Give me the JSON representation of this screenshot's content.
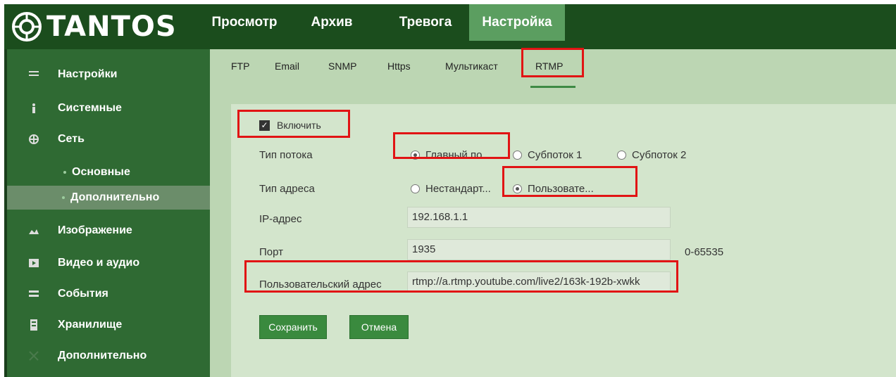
{
  "brand": {
    "logo_text": "TANTOS"
  },
  "nav": {
    "tabs": [
      {
        "label": "Просмотр"
      },
      {
        "label": "Архив"
      },
      {
        "label": "Тревога"
      },
      {
        "label": "Настройка"
      }
    ],
    "active_tab": "Настройка"
  },
  "sidebar": {
    "items": [
      {
        "label": "Настройки",
        "icon": "menu-icon"
      },
      {
        "label": "Системные",
        "icon": "info-icon"
      },
      {
        "label": "Сеть",
        "icon": "network-icon"
      },
      {
        "label": "Основные",
        "icon": "dot"
      },
      {
        "label": "Дополнительно",
        "icon": "dot",
        "active": true
      },
      {
        "label": "Изображение",
        "icon": "image-icon"
      },
      {
        "label": "Видео и аудио",
        "icon": "video-icon"
      },
      {
        "label": "События",
        "icon": "events-icon"
      },
      {
        "label": "Хранилище",
        "icon": "storage-icon"
      },
      {
        "label": "Дополнительно",
        "icon": "extra-icon"
      }
    ]
  },
  "subtabs": {
    "items": [
      "FTP",
      "Email",
      "SNMP",
      "Https",
      "Мультикаст",
      "RTMP"
    ],
    "active": "RTMP"
  },
  "form": {
    "enable_label": "Включить",
    "enable_checked": true,
    "stream_type": {
      "label": "Тип потока",
      "options": [
        "Главный по...",
        "Субпоток 1",
        "Субпоток 2"
      ],
      "selected": "Главный по..."
    },
    "address_type": {
      "label": "Тип адреса",
      "options": [
        "Нестандарт...",
        "Пользовате..."
      ],
      "selected": "Пользовате..."
    },
    "ip": {
      "label": "IP-адрес",
      "value": "192.168.1.1"
    },
    "port": {
      "label": "Порт",
      "value": "1935",
      "range": "0-65535"
    },
    "custom_address": {
      "label": "Пользовательский адрес",
      "value": "rtmp://a.rtmp.youtube.com/live2/163k-192b-xwkk"
    },
    "save_label": "Сохранить",
    "cancel_label": "Отмена"
  },
  "colors": {
    "topbar": "#1b4d1d",
    "active_tab": "#5b9e60",
    "sidebar": "#2f6a33",
    "content_bg": "#bcd6b3",
    "highlight": "#e11414",
    "button": "#3a8a3e"
  }
}
